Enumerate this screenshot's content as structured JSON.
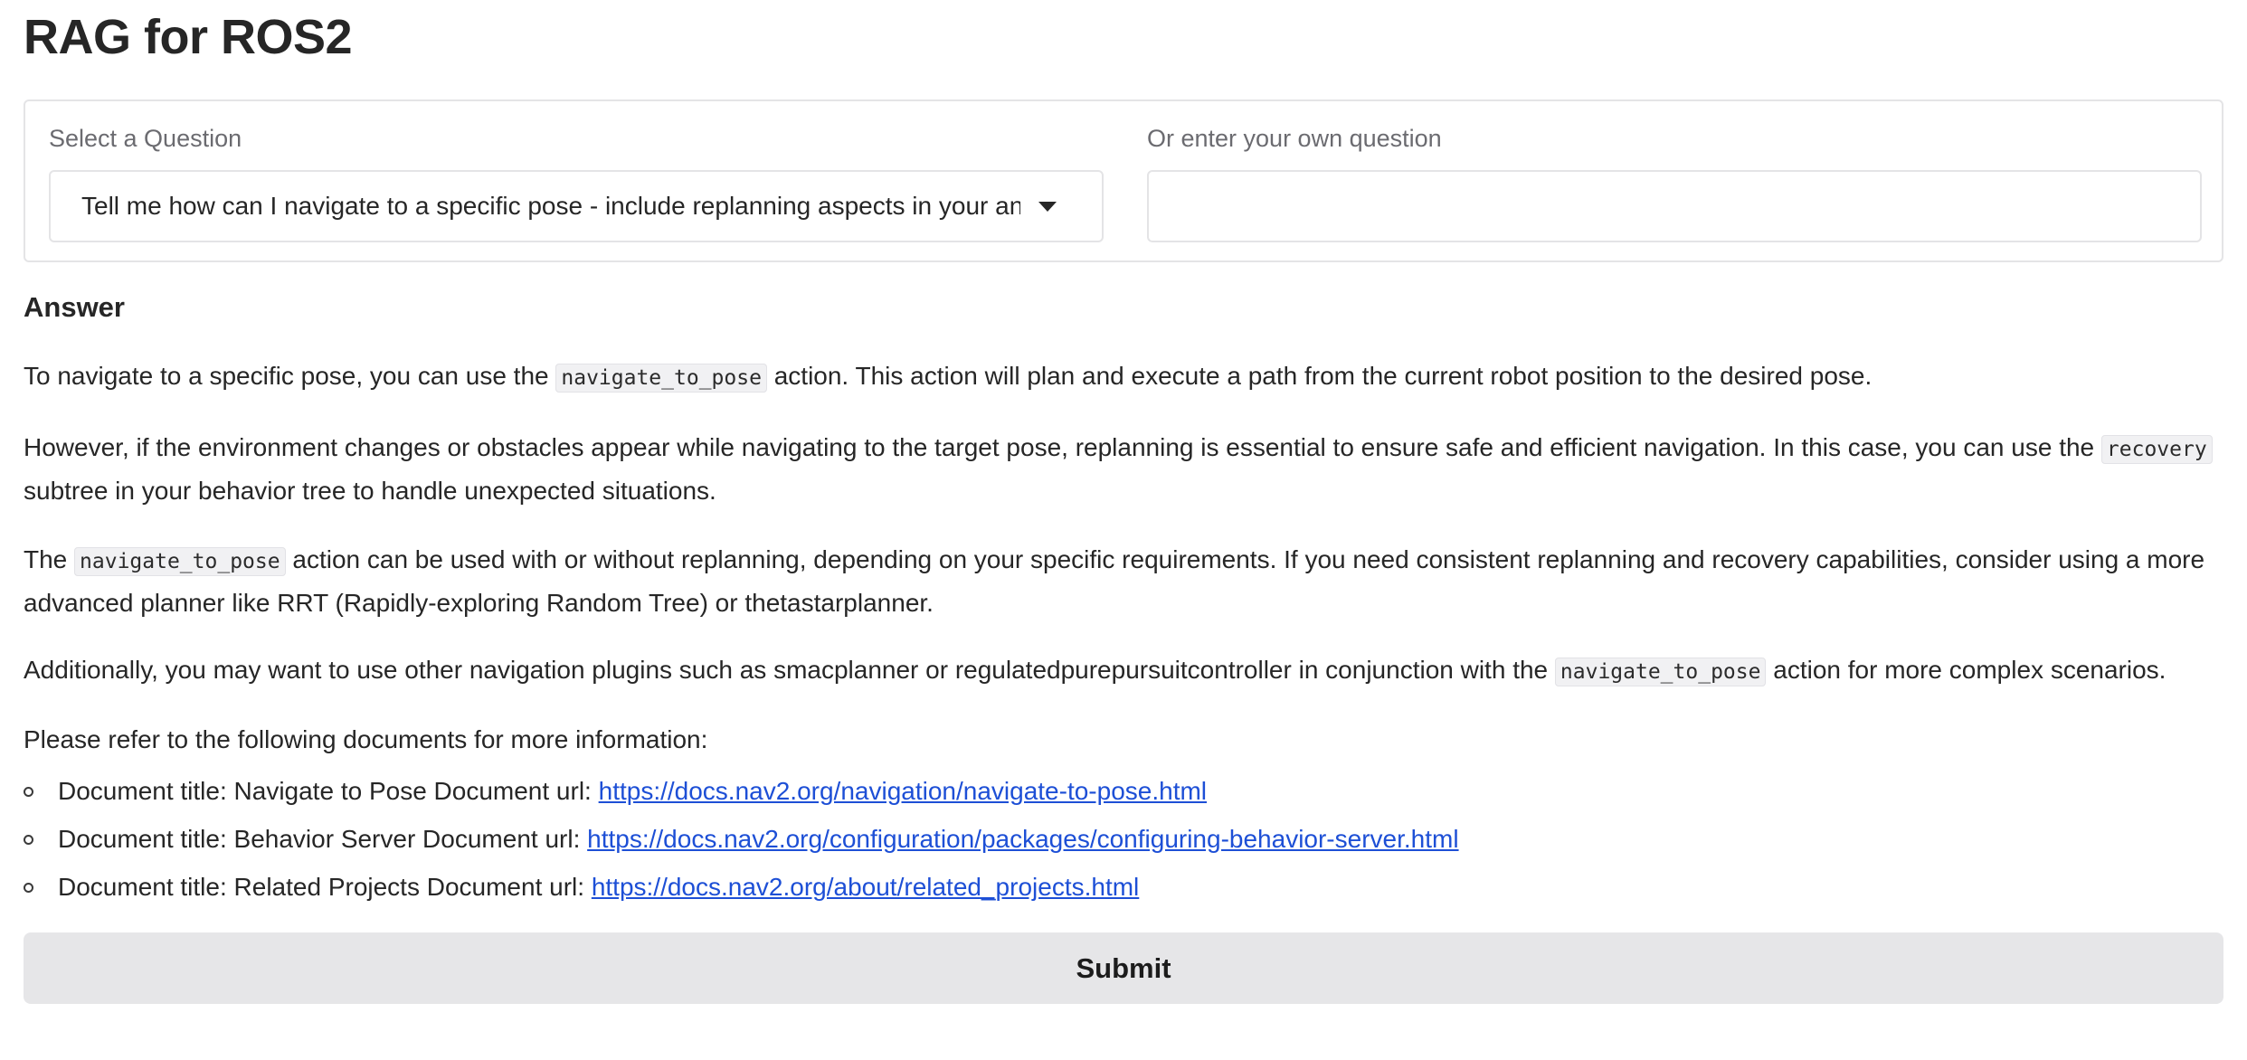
{
  "app": {
    "title": "RAG for ROS2"
  },
  "form": {
    "select_label": "Select a Question",
    "select_value": "Tell me how can I navigate to a specific pose - include replanning aspects in your answer.",
    "custom_label": "Or enter your own question",
    "custom_value": "",
    "custom_placeholder": ""
  },
  "answer": {
    "heading": "Answer",
    "p1": {
      "before": "To navigate to a specific pose, you can use the ",
      "code": "navigate_to_pose",
      "after": " action. This action will plan and execute a path from the current robot position to the desired pose."
    },
    "p2": {
      "before": "However, if the environment changes or obstacles appear while navigating to the target pose, replanning is essential to ensure safe and efficient navigation. In this case, you can use the ",
      "code": "recovery",
      "after": " subtree in your behavior tree to handle unexpected situations."
    },
    "p3": {
      "before": "The ",
      "code": "navigate_to_pose",
      "after": " action can be used with or without replanning, depending on your specific requirements. If you need consistent replanning and recovery capabilities, consider using a more advanced planner like RRT (Rapidly-exploring Random Tree) or thetastarplanner."
    },
    "p4": {
      "before": "Additionally, you may want to use other navigation plugins such as smacplanner or regulatedpurepursuitcontroller in conjunction with the ",
      "code": "navigate_to_pose",
      "after": " action for more complex scenarios."
    },
    "refs_intro": "Please refer to the following documents for more information:",
    "refs": [
      {
        "prefix": "Document title: Navigate to Pose Document url: ",
        "url": "https://docs.nav2.org/navigation/navigate-to-pose.html"
      },
      {
        "prefix": "Document title: Behavior Server Document url: ",
        "url": "https://docs.nav2.org/configuration/packages/configuring-behavior-server.html"
      },
      {
        "prefix": "Document title: Related Projects Document url: ",
        "url": "https://docs.nav2.org/about/related_projects.html"
      }
    ]
  },
  "actions": {
    "submit_label": "Submit"
  },
  "colors": {
    "link": "#1d4fd6",
    "button_bg": "#e6e6e8",
    "border": "#e4e4e6",
    "label": "#6b6b70"
  }
}
